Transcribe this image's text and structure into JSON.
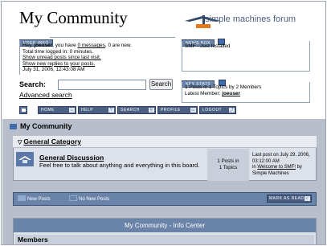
{
  "header": {
    "site_title": "My Community",
    "logo_text": "simple machines forum"
  },
  "user_info": {
    "label": "USER INFO",
    "greeting_pre": "Hey, ",
    "username": "joeuser",
    "greeting_mid": ", you have ",
    "messages_link": "0 messages",
    "greeting_post": ", 0 are new.",
    "time_logged": "Total time logged in: 0 minutes.",
    "unread_link": "Show unread posts since last visit.",
    "replies_link": "Show new replies to your posts.",
    "datetime": "July 31, 2006, 12:43:08 AM"
  },
  "news": {
    "label": "NEWS BOX",
    "text": "SMF - Just Installed"
  },
  "stats": {
    "label": "KEY STATS",
    "line1": "1 Posts in 1 Topics by 2 Members",
    "latest_label": "Latest Member: ",
    "latest_member": "joeuser"
  },
  "search": {
    "label": "Search:",
    "value": "",
    "button": "Search",
    "advanced": "Advanced search"
  },
  "nav": {
    "home": "HOME",
    "help": "HELP",
    "search": "SEARCH",
    "profile": "PROFILE",
    "logout": "LOGOUT",
    "help_icon": "?"
  },
  "forum": {
    "title": "My Community",
    "category": "General Category",
    "board_name": "General Discussion",
    "board_desc": "Feel free to talk about anything and everything in this board.",
    "posts": "1 Posts in",
    "topics": "1 Topics",
    "last_post_line1": "Last post on July 29, 2006,",
    "last_post_line2": "03:12:00 AM",
    "last_post_in": "in ",
    "last_post_topic": "Welcome to SMF!",
    "last_post_by": " by",
    "last_post_author": "Simple Machines"
  },
  "legend": {
    "new_posts": "New Posts",
    "no_new_posts": "No New Posts",
    "mark_read": "MARK AS READ"
  },
  "info_center": {
    "title": "My Community - Info Center",
    "members": "Members"
  }
}
